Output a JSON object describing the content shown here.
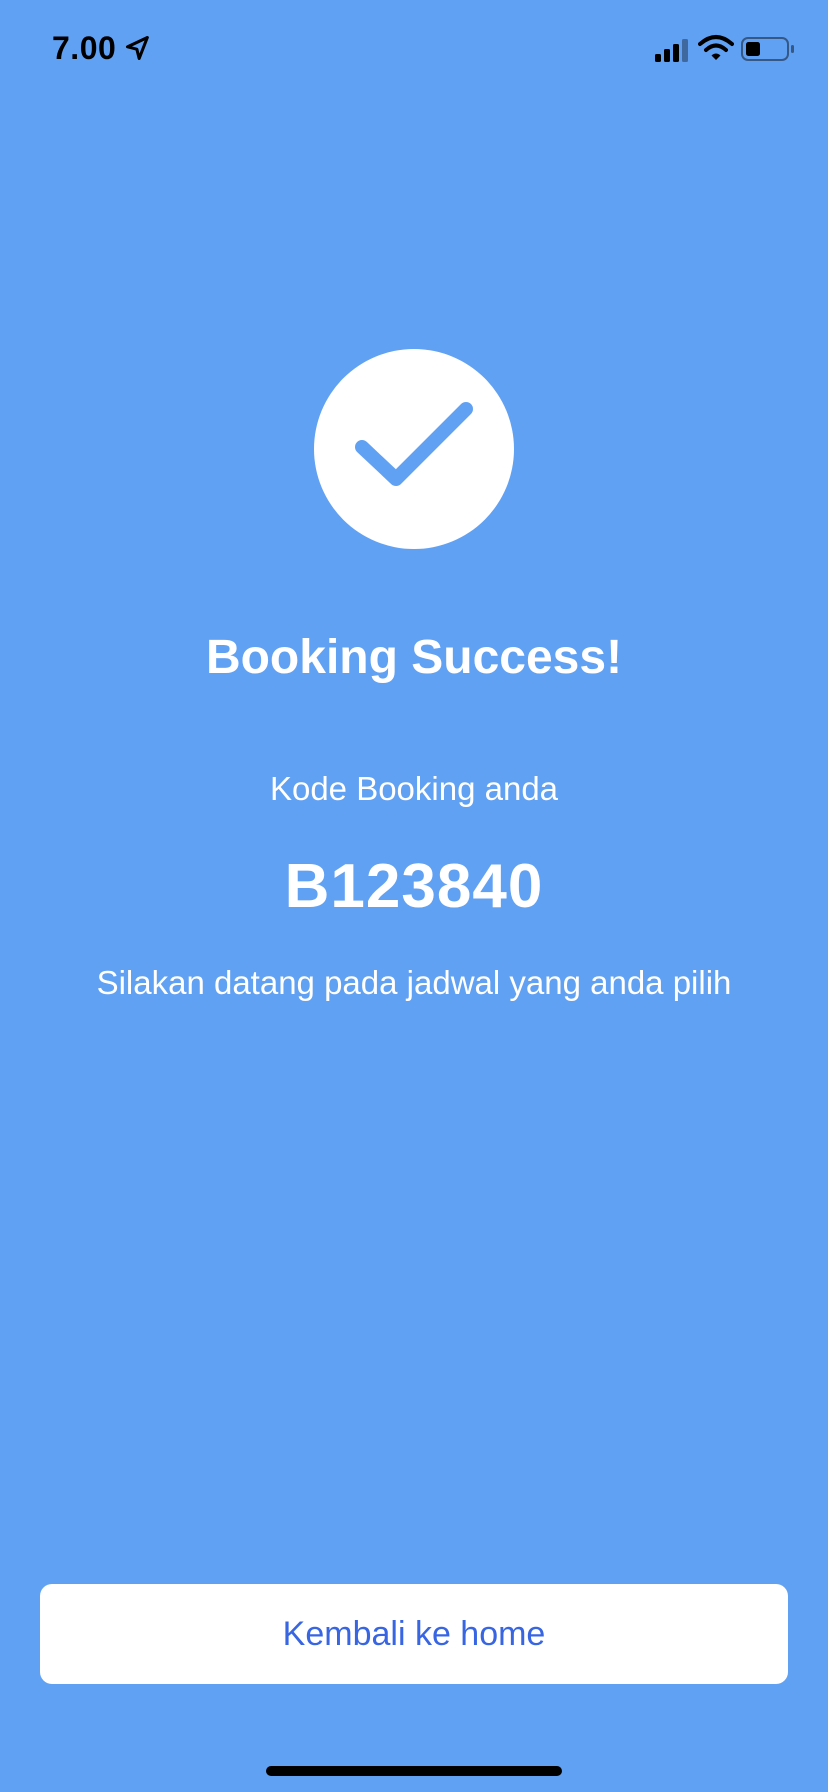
{
  "status_bar": {
    "time": "7.00",
    "icons": [
      "location-arrow-icon",
      "cellular-signal-icon",
      "wifi-icon",
      "battery-icon"
    ]
  },
  "success": {
    "icon": "checkmark-icon",
    "title": "Booking Success!",
    "code_label": "Kode Booking anda",
    "booking_code": "B123840",
    "message": "Silakan datang pada jadwal yang anda pilih"
  },
  "actions": {
    "home_button_label": "Kembali ke home"
  },
  "colors": {
    "background": "#61a1f3",
    "button_background": "#ffffff",
    "button_text": "#3866e3",
    "check_stroke": "#61a1f3"
  }
}
